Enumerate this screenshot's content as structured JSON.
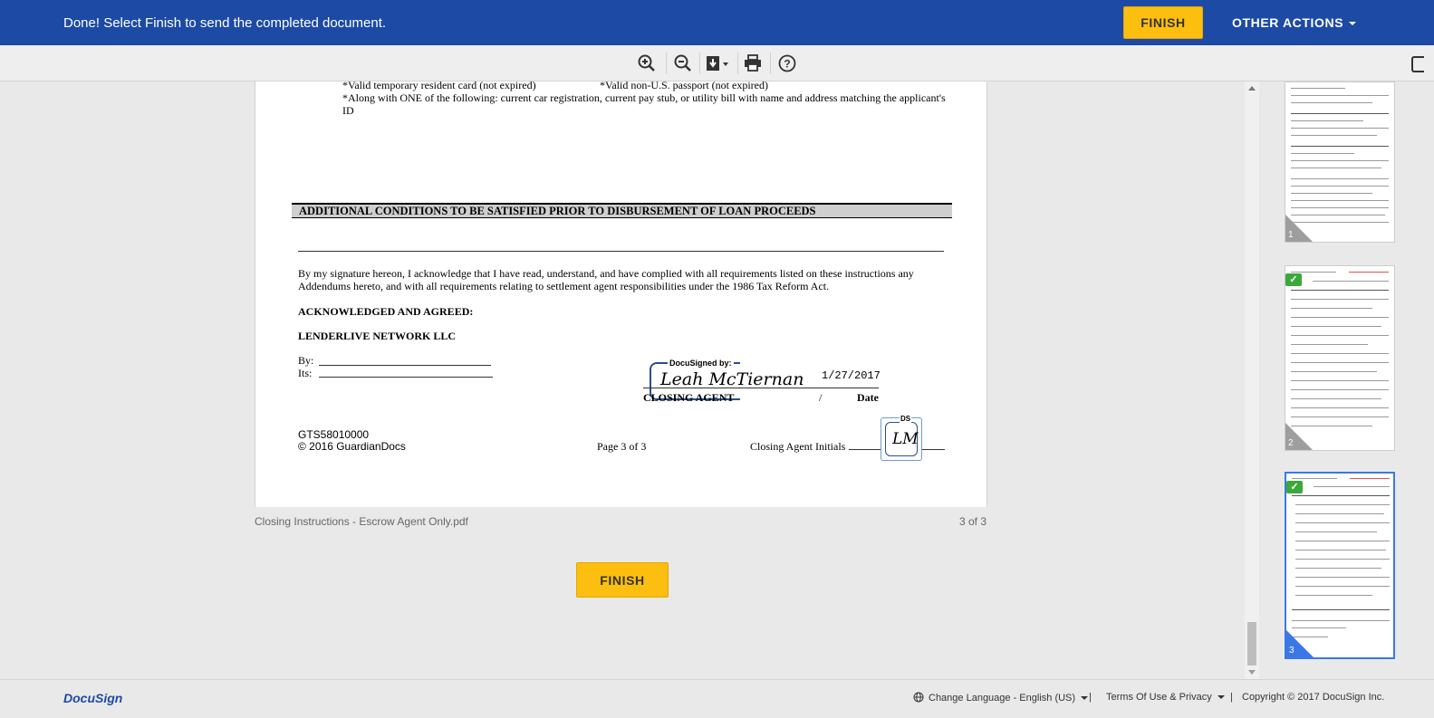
{
  "banner": {
    "message": "Done! Select Finish to send the completed document.",
    "finish_label": "FINISH",
    "other_actions_label": "OTHER ACTIONS"
  },
  "toolbar": {
    "icons": [
      "zoom-in-icon",
      "zoom-out-icon",
      "download-icon",
      "print-icon",
      "help-icon"
    ]
  },
  "document": {
    "line_resident_card": "*Valid temporary resident card (not expired)",
    "line_passport": "*Valid non-U.S. passport (not expired)",
    "line_along_1": "*Along with ONE of the following: current car registration, current pay stub, or utility bill with name and address matching the applicant's",
    "line_along_2": "ID",
    "section_title": "ADDITIONAL CONDITIONS TO BE SATISFIED PRIOR TO DISBURSEMENT OF LOAN PROCEEDS",
    "ack_para_1": "By my signature hereon, I acknowledge that I have read, understand, and have complied with all requirements listed on these instructions any",
    "ack_para_2": "Addendums hereto, and with all requirements relating to settlement agent responsibilities under the 1986 Tax Reform Act.",
    "ack_heading": "ACKNOWLEDGED AND AGREED:",
    "company": "LENDERLIVE NETWORK LLC",
    "by_label": "By:",
    "its_label": "Its:",
    "docusigned_label": "DocuSigned by:",
    "signature": "Leah McTiernan",
    "sign_date": "1/27/2017",
    "closing_agent_label": "CLOSING AGENT",
    "slash": "/",
    "date_label": "Date",
    "doc_code": "GTS58010000",
    "copyright": "© 2016 GuardianDocs",
    "page_label": "Page 3 of 3",
    "initials_label": "Closing Agent Initials",
    "initials_ds": "DS",
    "initials": "LM"
  },
  "viewer": {
    "file_name": "Closing Instructions - Escrow Agent Only.pdf",
    "page_count": "3 of 3",
    "finish_label": "FINISH"
  },
  "thumbnails": [
    {
      "number": "1",
      "completed": false,
      "active": false
    },
    {
      "number": "2",
      "completed": true,
      "active": false
    },
    {
      "number": "3",
      "completed": true,
      "active": true
    }
  ],
  "footer": {
    "logo": "DocuSign",
    "language": "Change Language - English (US)",
    "separator": "|",
    "terms": "Terms Of Use & Privacy",
    "copyright": "Copyright © 2017 DocuSign Inc."
  },
  "colors": {
    "banner_bg": "#1d4aa5",
    "finish_button": "#fdbf0f",
    "active_thumb": "#3b78e7",
    "check_green": "#3aa83a"
  }
}
